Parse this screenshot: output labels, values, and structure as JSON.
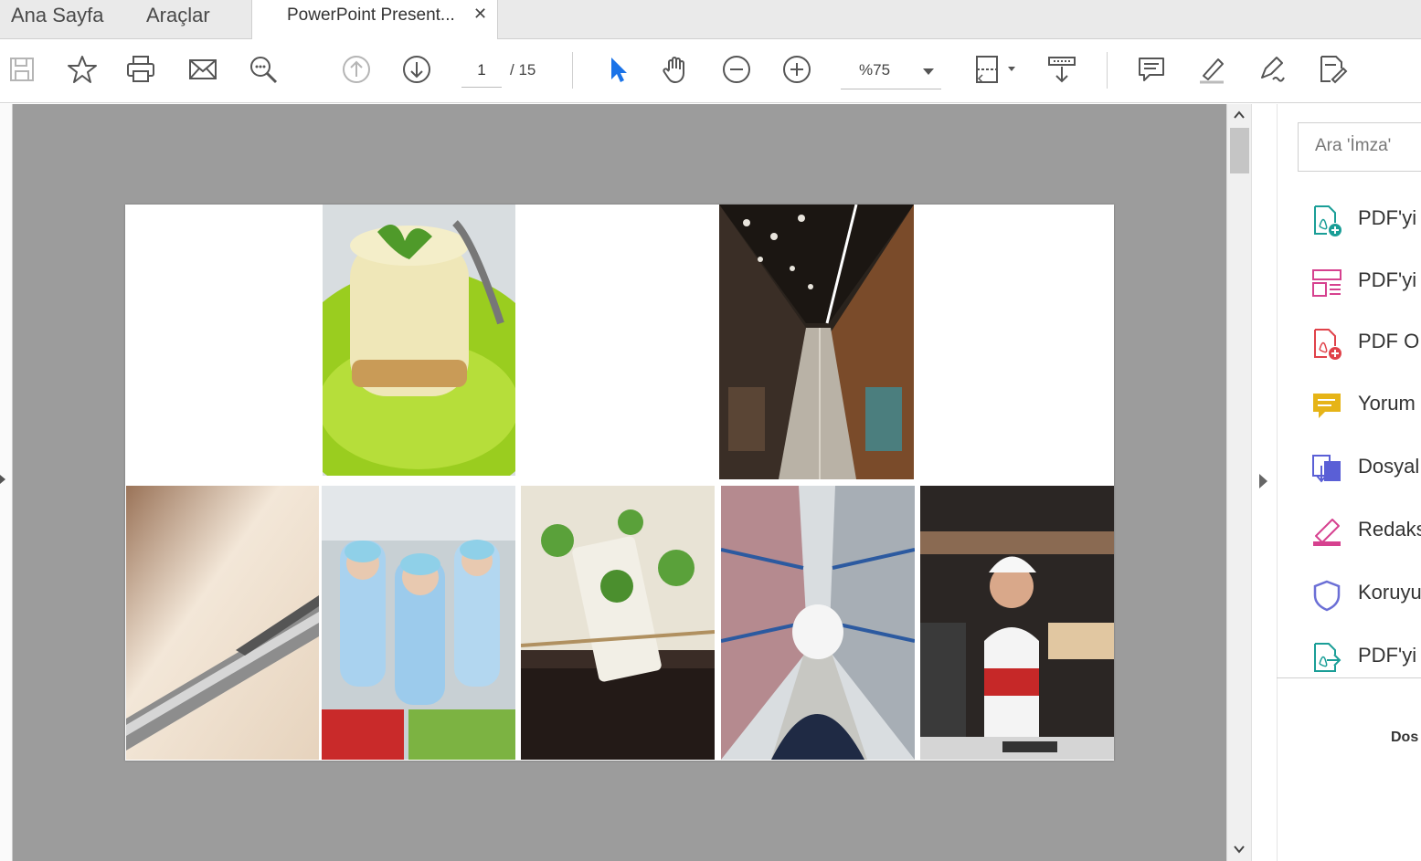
{
  "tabs": {
    "home": "Ana Sayfa",
    "tools": "Araçlar",
    "document": "PowerPoint Present...",
    "close": "✕"
  },
  "toolbar": {
    "page_current": "1",
    "page_total": "/  15",
    "zoom": "%75"
  },
  "right_pane": {
    "search_placeholder": "Ara 'İmza'",
    "tools": [
      {
        "label": "PDF'yi",
        "icon": "create-pdf-icon",
        "color": "#1a9e97"
      },
      {
        "label": "PDF'yi",
        "icon": "edit-pdf-icon",
        "color": "#d6418f"
      },
      {
        "label": "PDF O",
        "icon": "pdf-plus-icon",
        "color": "#e0424a"
      },
      {
        "label": "Yorum",
        "icon": "comment-icon",
        "color": "#e6b417"
      },
      {
        "label": "Dosyal",
        "icon": "combine-files-icon",
        "color": "#5a5fd6"
      },
      {
        "label": "Redaks",
        "icon": "redact-icon",
        "color": "#d6418f"
      },
      {
        "label": "Koruyu",
        "icon": "shield-icon",
        "color": "#6b6fd6"
      },
      {
        "label": "PDF'yi",
        "icon": "export-pdf-icon",
        "color": "#1a9e97"
      }
    ],
    "bottom_text": "Dos"
  }
}
